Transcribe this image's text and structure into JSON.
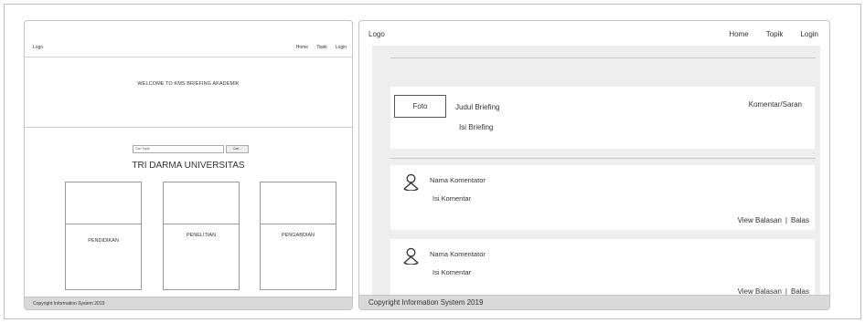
{
  "left_mockup": {
    "logo": "Logo",
    "nav": [
      "Home",
      "Topik",
      "Login"
    ],
    "welcome": "WELCOME TO KMS BRIEFING AKADEMIK",
    "search": {
      "placeholder": "Cari Topik",
      "button": "Cari..."
    },
    "heading": "TRI DARMA UNIVERSITAS",
    "cards": [
      "PENDIDIKAN",
      "PENELITIAN",
      "PENGABDIAN"
    ],
    "footer": "Copyright Information System 2019"
  },
  "right_mockup": {
    "logo": "Logo",
    "nav": [
      "Home",
      "Topik",
      "Login"
    ],
    "post": {
      "foto": "Foto",
      "judul": "Judul Briefing",
      "isi": "Isi Briefing",
      "komentar_saran": "Komentar/Saran"
    },
    "comments": [
      {
        "nama": "Nama Komentator",
        "isi": "Isi Komentar",
        "view": "View Balasan",
        "separator": "|",
        "balas": "Balas"
      },
      {
        "nama": "Nama Komentator",
        "isi": "Isi Komentar",
        "view": "View Balasan",
        "separator": "|",
        "balas": "Balas"
      }
    ],
    "footer": "Copyright Information System 2019"
  },
  "icons": {
    "avatar": "user-avatar-icon"
  }
}
